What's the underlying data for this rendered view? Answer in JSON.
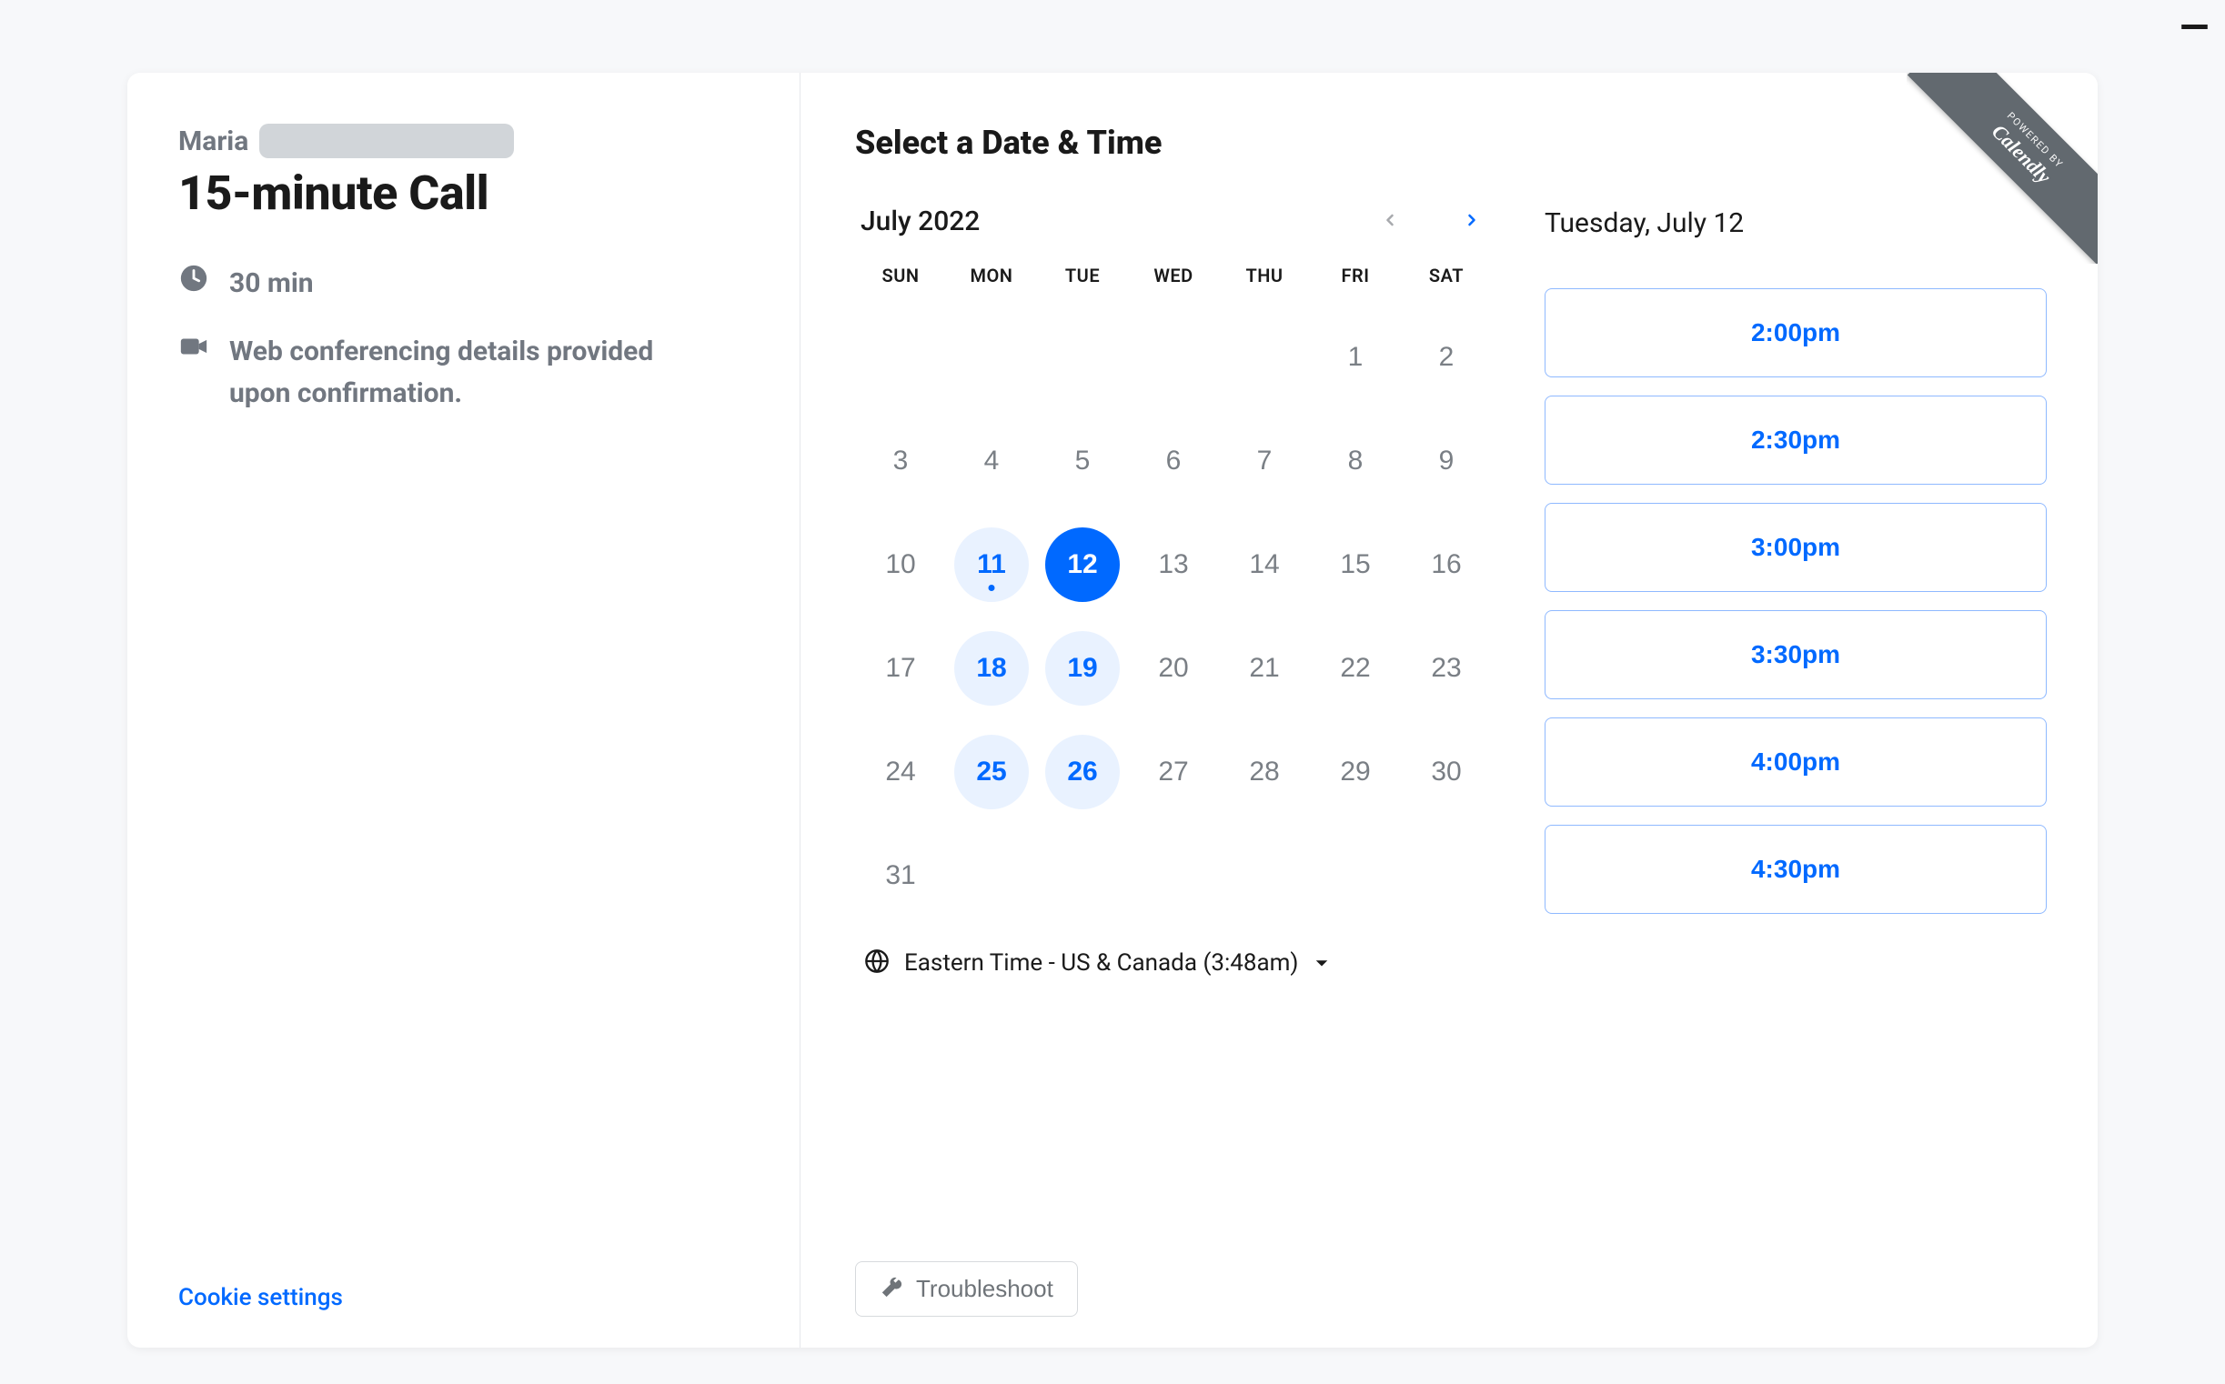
{
  "ribbon": {
    "small": "POWERED BY",
    "big": "Calendly"
  },
  "host": {
    "first_name": "Maria"
  },
  "event": {
    "title": "15-minute Call",
    "duration_label": "30 min",
    "location_label": "Web conferencing details provided upon confirmation."
  },
  "cookie_link": "Cookie settings",
  "heading": "Select a Date & Time",
  "calendar": {
    "month_label": "July 2022",
    "dow": [
      "SUN",
      "MON",
      "TUE",
      "WED",
      "THU",
      "FRI",
      "SAT"
    ],
    "weeks": [
      [
        null,
        null,
        null,
        null,
        null,
        {
          "n": 1
        },
        {
          "n": 2
        }
      ],
      [
        {
          "n": 3
        },
        {
          "n": 4
        },
        {
          "n": 5
        },
        {
          "n": 6
        },
        {
          "n": 7
        },
        {
          "n": 8
        },
        {
          "n": 9
        }
      ],
      [
        {
          "n": 10
        },
        {
          "n": 11,
          "available": true,
          "today": true
        },
        {
          "n": 12,
          "available": true,
          "selected": true
        },
        {
          "n": 13
        },
        {
          "n": 14
        },
        {
          "n": 15
        },
        {
          "n": 16
        }
      ],
      [
        {
          "n": 17
        },
        {
          "n": 18,
          "available": true
        },
        {
          "n": 19,
          "available": true
        },
        {
          "n": 20
        },
        {
          "n": 21
        },
        {
          "n": 22
        },
        {
          "n": 23
        }
      ],
      [
        {
          "n": 24
        },
        {
          "n": 25,
          "available": true
        },
        {
          "n": 26,
          "available": true
        },
        {
          "n": 27
        },
        {
          "n": 28
        },
        {
          "n": 29
        },
        {
          "n": 30
        }
      ],
      [
        {
          "n": 31
        },
        null,
        null,
        null,
        null,
        null,
        null
      ]
    ]
  },
  "timezone": {
    "label": "Eastern Time - US & Canada (3:48am)"
  },
  "selected_date_label": "Tuesday, July 12",
  "time_slots": [
    "2:00pm",
    "2:30pm",
    "3:00pm",
    "3:30pm",
    "4:00pm",
    "4:30pm"
  ],
  "troubleshoot_label": "Troubleshoot"
}
